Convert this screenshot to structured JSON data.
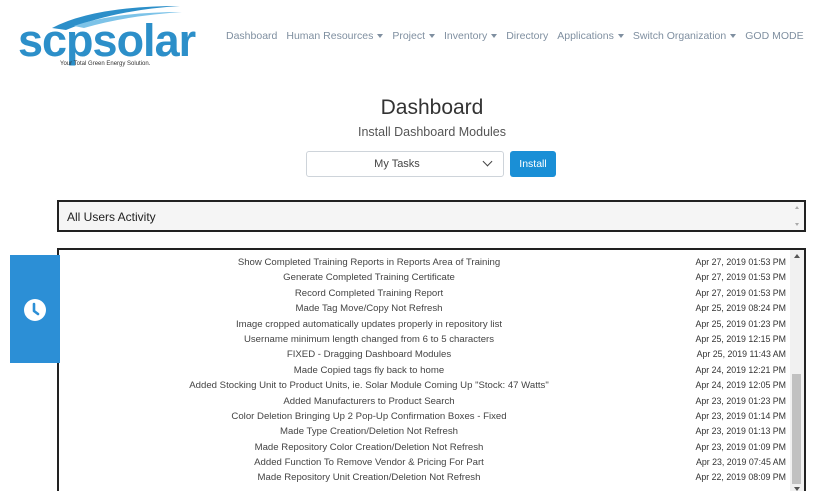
{
  "header": {
    "logo": {
      "brand_left": "scp",
      "brand_right": "solar",
      "tagline": "Your Total Green Energy Solution."
    },
    "nav": [
      {
        "label": "Dashboard",
        "dropdown": false
      },
      {
        "label": "Human Resources",
        "dropdown": true
      },
      {
        "label": "Project",
        "dropdown": true
      },
      {
        "label": "Inventory",
        "dropdown": true
      },
      {
        "label": "Directory",
        "dropdown": false
      },
      {
        "label": "Applications",
        "dropdown": true
      },
      {
        "label": "Switch Organization",
        "dropdown": true
      },
      {
        "label": "GOD MODE",
        "dropdown": false
      }
    ]
  },
  "main": {
    "title": "Dashboard",
    "subtitle": "Install Dashboard Modules",
    "module_select": {
      "value": "My Tasks"
    },
    "install_label": "Install",
    "activity_header": "All Users Activity",
    "tasks": [
      {
        "task": "Show Completed Training Reports in Reports Area of Training",
        "time": "Apr 27, 2019 01:53 PM"
      },
      {
        "task": "Generate Completed Training Certificate",
        "time": "Apr 27, 2019 01:53 PM"
      },
      {
        "task": "Record Completed Training Report",
        "time": "Apr 27, 2019 01:53 PM"
      },
      {
        "task": "Made Tag Move/Copy Not Refresh",
        "time": "Apr 25, 2019 08:24 PM"
      },
      {
        "task": "Image cropped automatically updates properly in repository list",
        "time": "Apr 25, 2019 01:23 PM"
      },
      {
        "task": "Username minimum length changed from 6 to 5 characters",
        "time": "Apr 25, 2019 12:15 PM"
      },
      {
        "task": "FIXED - Dragging Dashboard Modules",
        "time": "Apr 25, 2019 11:43 AM"
      },
      {
        "task": "Made Copied tags fly back to home",
        "time": "Apr 24, 2019 12:21 PM"
      },
      {
        "task": "Added Stocking Unit to Product Units, ie. Solar Module Coming Up \"Stock: 47 Watts\"",
        "time": "Apr 24, 2019 12:05 PM"
      },
      {
        "task": "Added Manufacturers to Product Search",
        "time": "Apr 23, 2019 01:23 PM"
      },
      {
        "task": "Color Deletion Bringing Up 2 Pop-Up Confirmation Boxes - Fixed",
        "time": "Apr 23, 2019 01:14 PM"
      },
      {
        "task": "Made Type Creation/Deletion Not Refresh",
        "time": "Apr 23, 2019 01:13 PM"
      },
      {
        "task": "Made Repository Color Creation/Deletion Not Refresh",
        "time": "Apr 23, 2019 01:09 PM"
      },
      {
        "task": "Added Function To Remove Vendor & Pricing For Part",
        "time": "Apr 23, 2019 07:45 AM"
      },
      {
        "task": "Made Repository Unit Creation/Deletion Not Refresh",
        "time": "Apr 22, 2019 08:09 PM"
      }
    ]
  },
  "colors": {
    "brand": "#2c8fc9",
    "accent": "#1a8fd6",
    "nav_text": "#7f8fa0"
  },
  "icons": {
    "clock_tab": "clock-icon"
  }
}
